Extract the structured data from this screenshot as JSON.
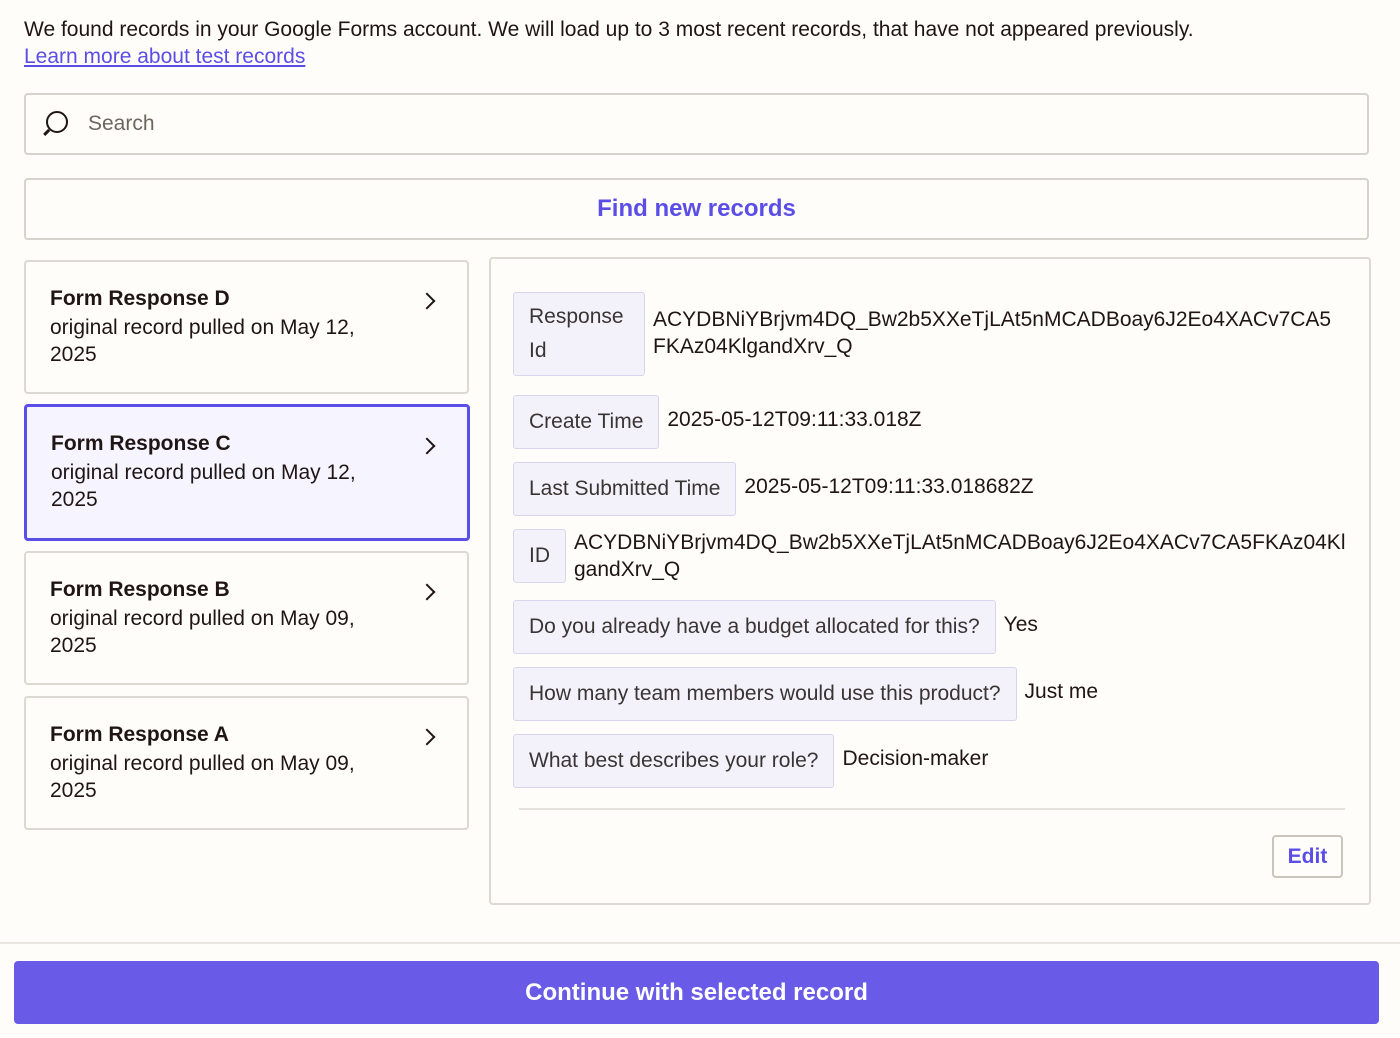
{
  "intro": {
    "text": "We found records in your Google Forms account. We will load up to 3 most recent records, that have not appeared previously.",
    "link": "Learn more about test records"
  },
  "search": {
    "placeholder": "Search",
    "value": ""
  },
  "find_button": "Find new records",
  "records": [
    {
      "title": "Form Response D",
      "subtitle": "original record pulled on May 12, 2025"
    },
    {
      "title": "Form Response C",
      "subtitle": "original record pulled on May 12, 2025"
    },
    {
      "title": "Form Response B",
      "subtitle": "original record pulled on May 09, 2025"
    },
    {
      "title": "Form Response A",
      "subtitle": "original record pulled on May 09, 2025"
    }
  ],
  "selected_record": "Form Response C",
  "details": [
    {
      "label": "Response Id",
      "value": "ACYDBNiYBrjvm4DQ_Bw2b5XXeTjLAt5nMCADBoay6J2Eo4XACv7CA5FKAz04KlgandXrv_Q"
    },
    {
      "label": "Create Time",
      "value": "2025-05-12T09:11:33.018Z"
    },
    {
      "label": "Last Submitted Time",
      "value": "2025-05-12T09:11:33.018682Z"
    },
    {
      "label": "ID",
      "value": "ACYDBNiYBrjvm4DQ_Bw2b5XXeTjLAt5nMCADBoay6J2Eo4XACv7CA5FKAz04KlgandXrv_Q"
    },
    {
      "label": "Do you already have a budget allocated for this?",
      "value": "Yes"
    },
    {
      "label": "How many team members would use this product?",
      "value": "Just me"
    },
    {
      "label": "What best describes your role?",
      "value": "Decision-maker"
    }
  ],
  "edit_button": "Edit",
  "continue_button": "Continue with selected record",
  "colors": {
    "accent": "#695be8",
    "link": "#5b4ee6",
    "selected_bg": "#f6f5ff"
  }
}
